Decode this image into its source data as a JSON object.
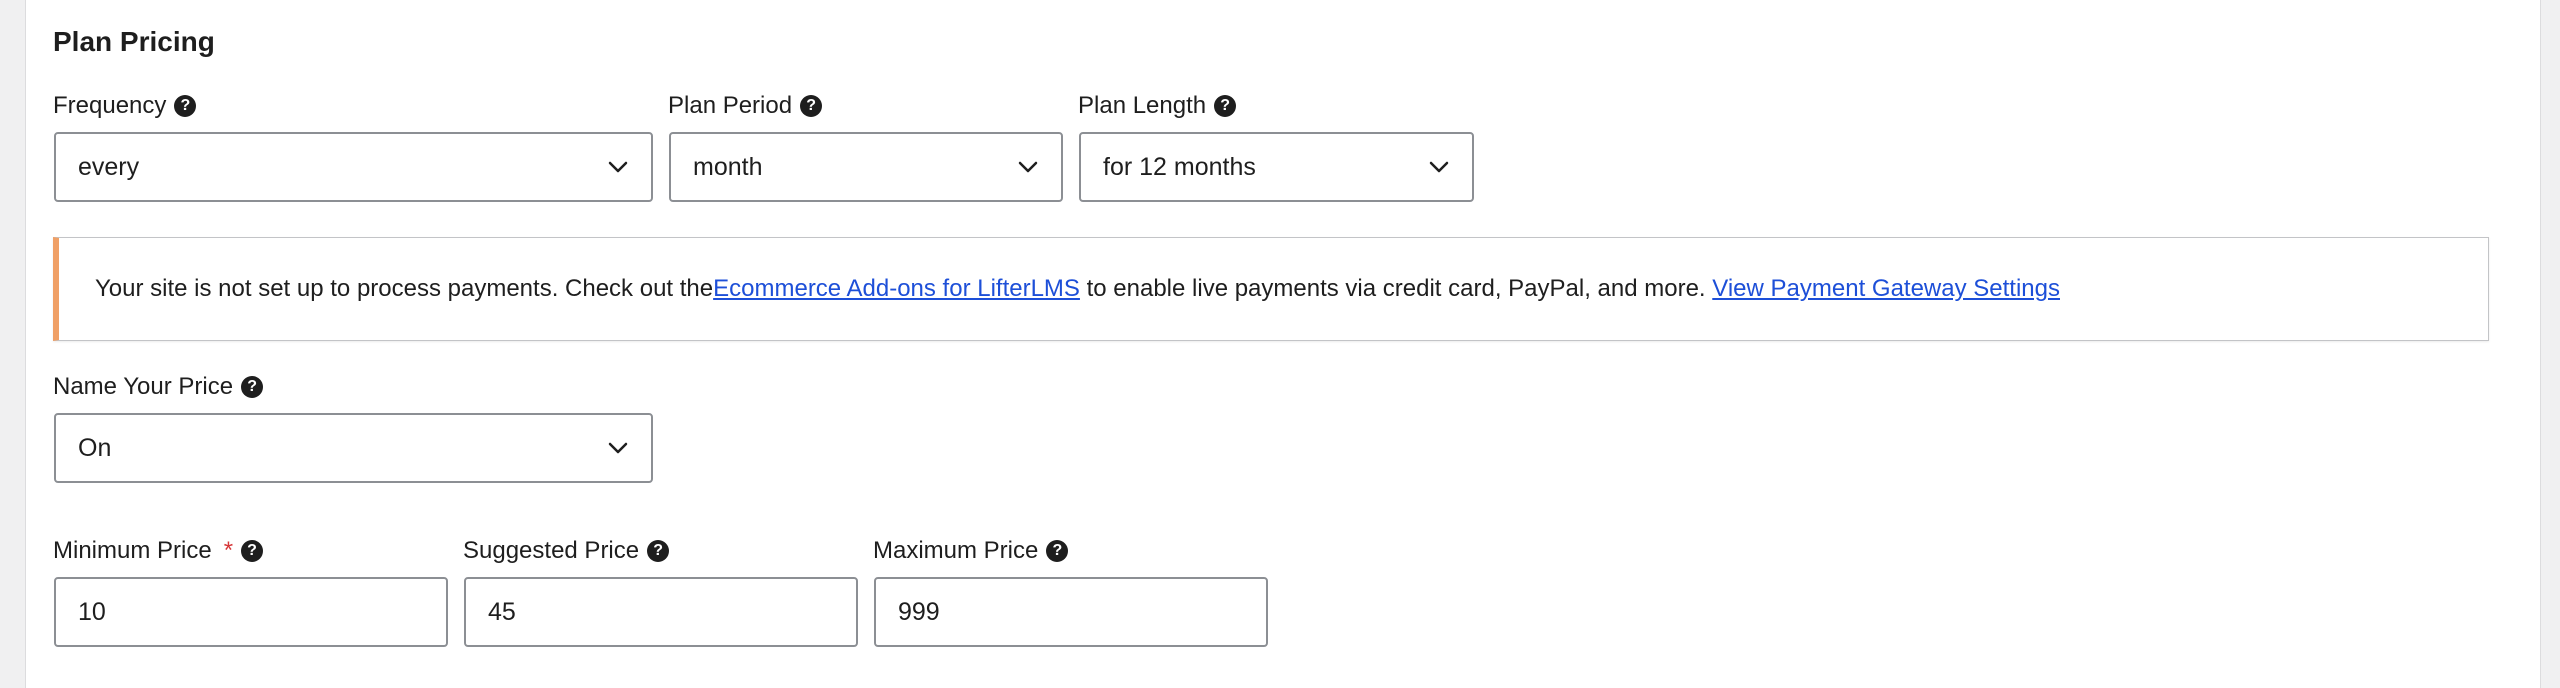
{
  "section": {
    "title": "Plan Pricing"
  },
  "fields": {
    "frequency": {
      "label": "Frequency",
      "value": "every"
    },
    "plan_period": {
      "label": "Plan Period",
      "value": "month"
    },
    "plan_length": {
      "label": "Plan Length",
      "value": "for 12 months"
    },
    "name_your_price": {
      "label": "Name Your Price",
      "value": "On"
    },
    "minimum_price": {
      "label": "Minimum Price",
      "required_mark": "*",
      "value": "10"
    },
    "suggested_price": {
      "label": "Suggested Price",
      "value": "45"
    },
    "maximum_price": {
      "label": "Maximum Price",
      "value": "999"
    }
  },
  "notice": {
    "text_before": "Your site is not set up to process payments. Check out the ",
    "link1": "Ecommerce Add-ons for LifterLMS",
    "text_middle": " to enable live payments via credit card, PayPal, and more. ",
    "link2": "View Payment Gateway Settings",
    "accent_color": "#f0a066"
  },
  "icons": {
    "help": "?",
    "chevron": "chevron-down-icon",
    "help_name": "question-circle-icon"
  }
}
